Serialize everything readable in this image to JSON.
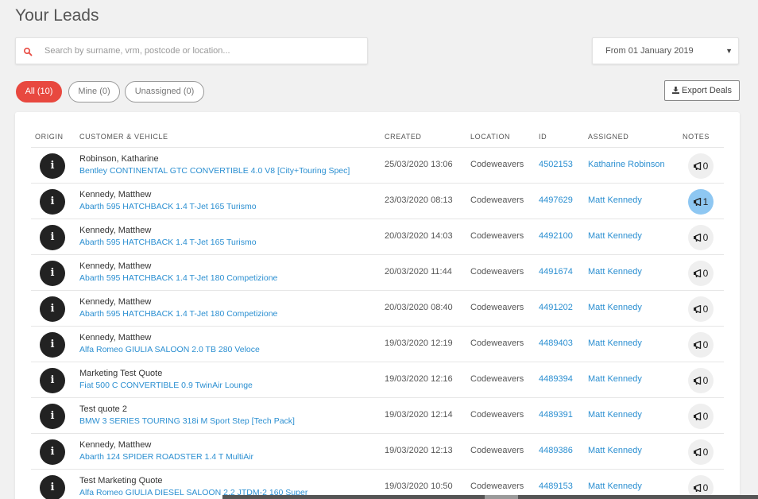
{
  "page": {
    "title": "Your Leads"
  },
  "search": {
    "placeholder": "Search by surname, vrm, postcode or location..."
  },
  "date_filter": {
    "selected": "From 01 January 2019"
  },
  "filters": {
    "all": "All (10)",
    "mine": "Mine (0)",
    "unassigned": "Unassigned (0)"
  },
  "toolbar": {
    "export_label": "Export Deals"
  },
  "table": {
    "headers": {
      "origin": "ORIGIN",
      "customer": "CUSTOMER & VEHICLE",
      "created": "CREATED",
      "location": "LOCATION",
      "id": "ID",
      "assigned": "ASSIGNED",
      "notes": "NOTES"
    },
    "rows": [
      {
        "name": "Robinson, Katharine",
        "vehicle": "Bentley CONTINENTAL GTC CONVERTIBLE 4.0 V8 [City+Touring Spec]",
        "created": "25/03/2020 13:06",
        "location": "Codeweavers",
        "id": "4502153",
        "assigned": "Katharine Robinson",
        "notes": "0"
      },
      {
        "name": "Kennedy, Matthew",
        "vehicle": "Abarth 595 HATCHBACK 1.4 T-Jet 165 Turismo",
        "created": "23/03/2020 08:13",
        "location": "Codeweavers",
        "id": "4497629",
        "assigned": "Matt Kennedy",
        "notes": "1"
      },
      {
        "name": "Kennedy, Matthew",
        "vehicle": "Abarth 595 HATCHBACK 1.4 T-Jet 165 Turismo",
        "created": "20/03/2020 14:03",
        "location": "Codeweavers",
        "id": "4492100",
        "assigned": "Matt Kennedy",
        "notes": "0"
      },
      {
        "name": "Kennedy, Matthew",
        "vehicle": "Abarth 595 HATCHBACK 1.4 T-Jet 180 Competizione",
        "created": "20/03/2020 11:44",
        "location": "Codeweavers",
        "id": "4491674",
        "assigned": "Matt Kennedy",
        "notes": "0"
      },
      {
        "name": "Kennedy, Matthew",
        "vehicle": "Abarth 595 HATCHBACK 1.4 T-Jet 180 Competizione",
        "created": "20/03/2020 08:40",
        "location": "Codeweavers",
        "id": "4491202",
        "assigned": "Matt Kennedy",
        "notes": "0"
      },
      {
        "name": "Kennedy, Matthew",
        "vehicle": "Alfa Romeo GIULIA SALOON 2.0 TB 280 Veloce",
        "created": "19/03/2020 12:19",
        "location": "Codeweavers",
        "id": "4489403",
        "assigned": "Matt Kennedy",
        "notes": "0"
      },
      {
        "name": "Marketing Test Quote",
        "vehicle": "Fiat 500 C CONVERTIBLE 0.9 TwinAir Lounge",
        "created": "19/03/2020 12:16",
        "location": "Codeweavers",
        "id": "4489394",
        "assigned": "Matt Kennedy",
        "notes": "0"
      },
      {
        "name": "Test quote 2",
        "vehicle": "BMW 3 SERIES TOURING 318i M Sport Step [Tech Pack]",
        "created": "19/03/2020 12:14",
        "location": "Codeweavers",
        "id": "4489391",
        "assigned": "Matt Kennedy",
        "notes": "0"
      },
      {
        "name": "Kennedy, Matthew",
        "vehicle": "Abarth 124 SPIDER ROADSTER 1.4 T MultiAir",
        "created": "19/03/2020 12:13",
        "location": "Codeweavers",
        "id": "4489386",
        "assigned": "Matt Kennedy",
        "notes": "0"
      },
      {
        "name": "Test Marketing Quote",
        "vehicle": "Alfa Romeo GIULIA DIESEL SALOON 2.2 JTDM-2 160 Super",
        "created": "19/03/2020 10:50",
        "location": "Codeweavers",
        "id": "4489153",
        "assigned": "Matt Kennedy",
        "notes": "0"
      }
    ]
  },
  "colors": {
    "accent": "#e8483f",
    "link": "#2b8fd1",
    "notes_active": "#8ec7f2"
  },
  "icons": {
    "search": "search-icon",
    "dropdown": "chevron-down-icon",
    "export": "download-icon",
    "origin": "info-icon",
    "notes": "megaphone-icon"
  }
}
